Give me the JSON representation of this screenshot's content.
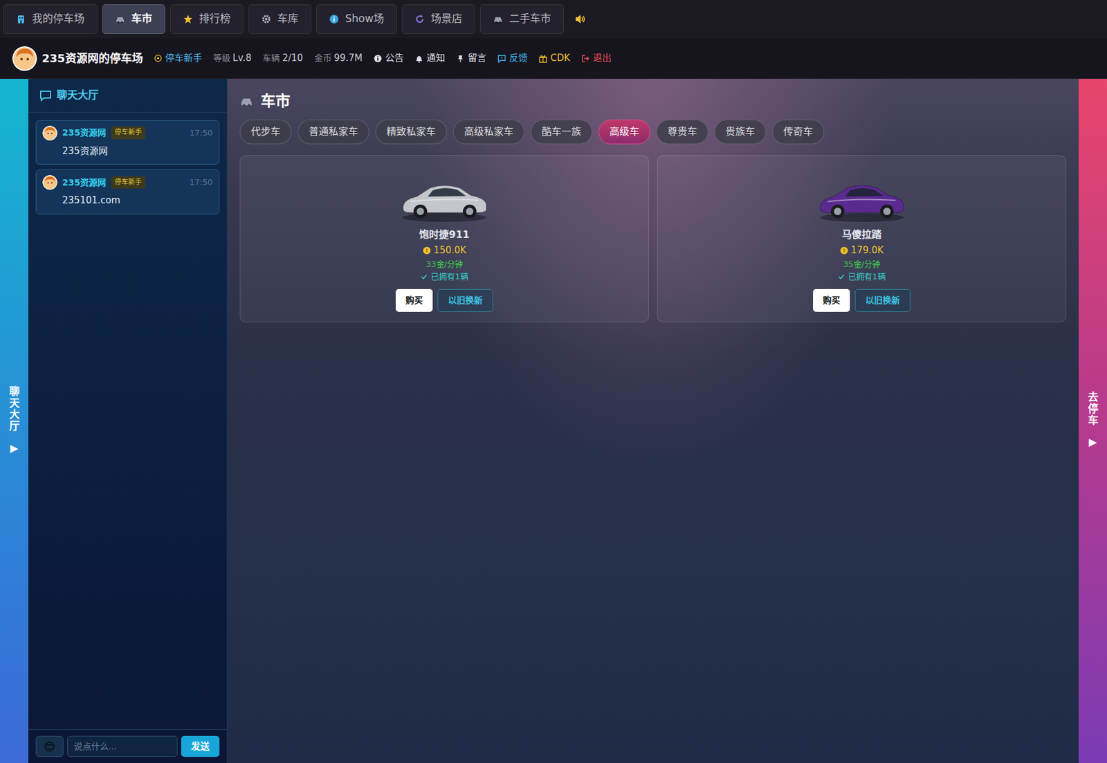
{
  "nav_tabs": [
    {
      "label": "我的停车场",
      "selected": false
    },
    {
      "label": "车市",
      "selected": true
    },
    {
      "label": "排行榜",
      "selected": false
    },
    {
      "label": "车库",
      "selected": false
    },
    {
      "label": "Show场",
      "selected": false
    },
    {
      "label": "场景店",
      "selected": false
    },
    {
      "label": "二手车市",
      "selected": false
    }
  ],
  "user": {
    "name": "235资源网的停车场",
    "rank": "停车新手",
    "stats": [
      {
        "label": "等级",
        "value": "Lv.8"
      },
      {
        "label": "车辆",
        "value": "2/10"
      },
      {
        "label": "金币",
        "value": "99.7M"
      }
    ]
  },
  "links": [
    {
      "label": "公告",
      "color": "#e0e0e8"
    },
    {
      "label": "通知",
      "color": "#e0e0e8"
    },
    {
      "label": "留言",
      "color": "#e0e0e8"
    },
    {
      "label": "反馈",
      "color": "#3fb8f0"
    },
    {
      "label": "CDK",
      "color": "#f1c232"
    },
    {
      "label": "退出",
      "color": "#f0505a"
    }
  ],
  "left_strip": {
    "label": "聊天大厅",
    "arrow": "▶"
  },
  "right_strip": {
    "label": "去停车",
    "arrow": "▶"
  },
  "chat": {
    "title": "聊天大厅",
    "messages": [
      {
        "user": "235资源网",
        "badge": "停车新手",
        "time": "17:50",
        "text": "235资源网"
      },
      {
        "user": "235资源网",
        "badge": "停车新手",
        "time": "17:50",
        "text": "235101.com"
      }
    ],
    "emoji": "😊",
    "placeholder": "说点什么...",
    "send": "发送"
  },
  "market": {
    "title": "车市",
    "categories": [
      {
        "label": "代步车",
        "selected": false
      },
      {
        "label": "普通私家车",
        "selected": false
      },
      {
        "label": "精致私家车",
        "selected": false
      },
      {
        "label": "高级私家车",
        "selected": false
      },
      {
        "label": "酷车一族",
        "selected": false
      },
      {
        "label": "高级车",
        "selected": true
      },
      {
        "label": "尊贵车",
        "selected": false
      },
      {
        "label": "贵族车",
        "selected": false
      },
      {
        "label": "传奇车",
        "selected": false
      }
    ],
    "cars": [
      {
        "name": "饱时捷911",
        "price": "150.0K",
        "income": "33金/分钟",
        "owned": "已拥有1辆",
        "color": "#c3c7cc",
        "buy": "购买",
        "trade": "以旧换新"
      },
      {
        "name": "马傻拉踏",
        "price": "179.0K",
        "income": "35金/分钟",
        "owned": "已拥有1辆",
        "color": "#5a2a90",
        "buy": "购买",
        "trade": "以旧换新"
      }
    ]
  }
}
